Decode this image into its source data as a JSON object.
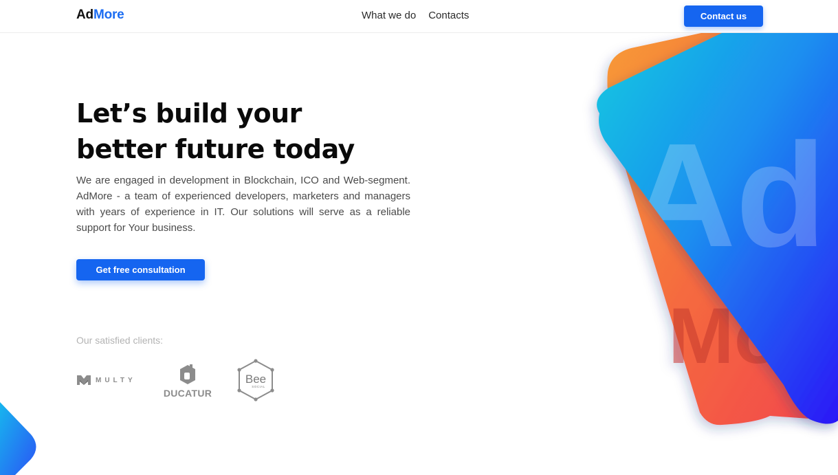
{
  "header": {
    "logo": {
      "part1": "Ad",
      "part2": "More"
    },
    "nav": [
      {
        "label": "What we do"
      },
      {
        "label": "Contacts"
      }
    ],
    "contact_button": "Contact us"
  },
  "hero": {
    "title_line1": "Let’s build your",
    "title_line2": "better future today",
    "description": "We are engaged in development in Blockchain, ICO and Web-segment. AdMore - a team of experienced developers, marketers and managers with years of experience in IT. Our solutions will serve as a reliable support for Your business.",
    "cta_button": "Get free consultation"
  },
  "clients": {
    "label": "Our satisfied clients:",
    "logos": [
      {
        "name": "MULTY",
        "icon": "multy-logo-icon"
      },
      {
        "name": "DUCATUR",
        "icon": "ducatur-logo-icon"
      },
      {
        "name": "Bee",
        "sub": "SOCIAL",
        "icon": "beesocial-logo-icon"
      }
    ]
  },
  "decoration": {
    "card_front_text": "Ad",
    "card_back_text": "Mo",
    "colors": {
      "accent": "#1565f0",
      "card_front_from": "#13c6e3",
      "card_front_to": "#2a1ef5",
      "card_back_from": "#f7883a",
      "card_back_to": "#f24e4a"
    }
  }
}
